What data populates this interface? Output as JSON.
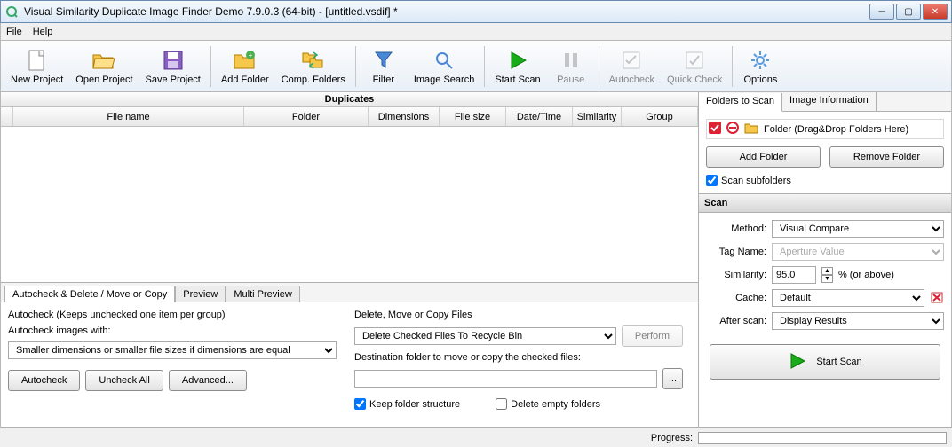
{
  "title": "Visual Similarity Duplicate Image Finder Demo 7.9.0.3 (64-bit) - [untitled.vsdif] *",
  "menu": {
    "file": "File",
    "help": "Help"
  },
  "toolbar": {
    "new_project": "New Project",
    "open_project": "Open Project",
    "save_project": "Save Project",
    "add_folder": "Add Folder",
    "comp_folders": "Comp. Folders",
    "filter": "Filter",
    "image_search": "Image Search",
    "start_scan": "Start Scan",
    "pause": "Pause",
    "autocheck": "Autocheck",
    "quick_check": "Quick Check",
    "options": "Options"
  },
  "grid": {
    "title": "Duplicates",
    "cols": {
      "filename": "File name",
      "folder": "Folder",
      "dimensions": "Dimensions",
      "filesize": "File size",
      "datetime": "Date/Time",
      "similarity": "Similarity",
      "group": "Group"
    }
  },
  "tabs": {
    "autocheck": "Autocheck & Delete / Move or Copy",
    "preview": "Preview",
    "multi": "Multi Preview"
  },
  "autocheck_panel": {
    "desc": "Autocheck (Keeps unchecked one item per group)",
    "with_label": "Autocheck images with:",
    "with_select": "Smaller dimensions or smaller file sizes if dimensions are equal",
    "btn_autocheck": "Autocheck",
    "btn_uncheck": "Uncheck All",
    "btn_advanced": "Advanced..."
  },
  "delete_panel": {
    "title": "Delete, Move or Copy Files",
    "action_select": "Delete Checked Files To Recycle Bin",
    "btn_perform": "Perform",
    "dest_label": "Destination folder to move or copy the checked files:",
    "keep_structure": "Keep folder structure",
    "delete_empty": "Delete empty folders"
  },
  "right": {
    "tab_folders": "Folders to Scan",
    "tab_info": "Image Information",
    "folder_hint": "Folder (Drag&Drop Folders Here)",
    "btn_add": "Add Folder",
    "btn_remove": "Remove Folder",
    "scan_subfolders": "Scan subfolders",
    "scan_title": "Scan",
    "method_label": "Method:",
    "method_value": "Visual Compare",
    "tag_label": "Tag Name:",
    "tag_value": "Aperture Value",
    "similarity_label": "Similarity:",
    "similarity_value": "95.0",
    "similarity_suffix": "%  (or above)",
    "cache_label": "Cache:",
    "cache_value": "Default",
    "after_label": "After scan:",
    "after_value": "Display Results",
    "start_scan": "Start Scan"
  },
  "status": {
    "progress_label": "Progress:"
  }
}
